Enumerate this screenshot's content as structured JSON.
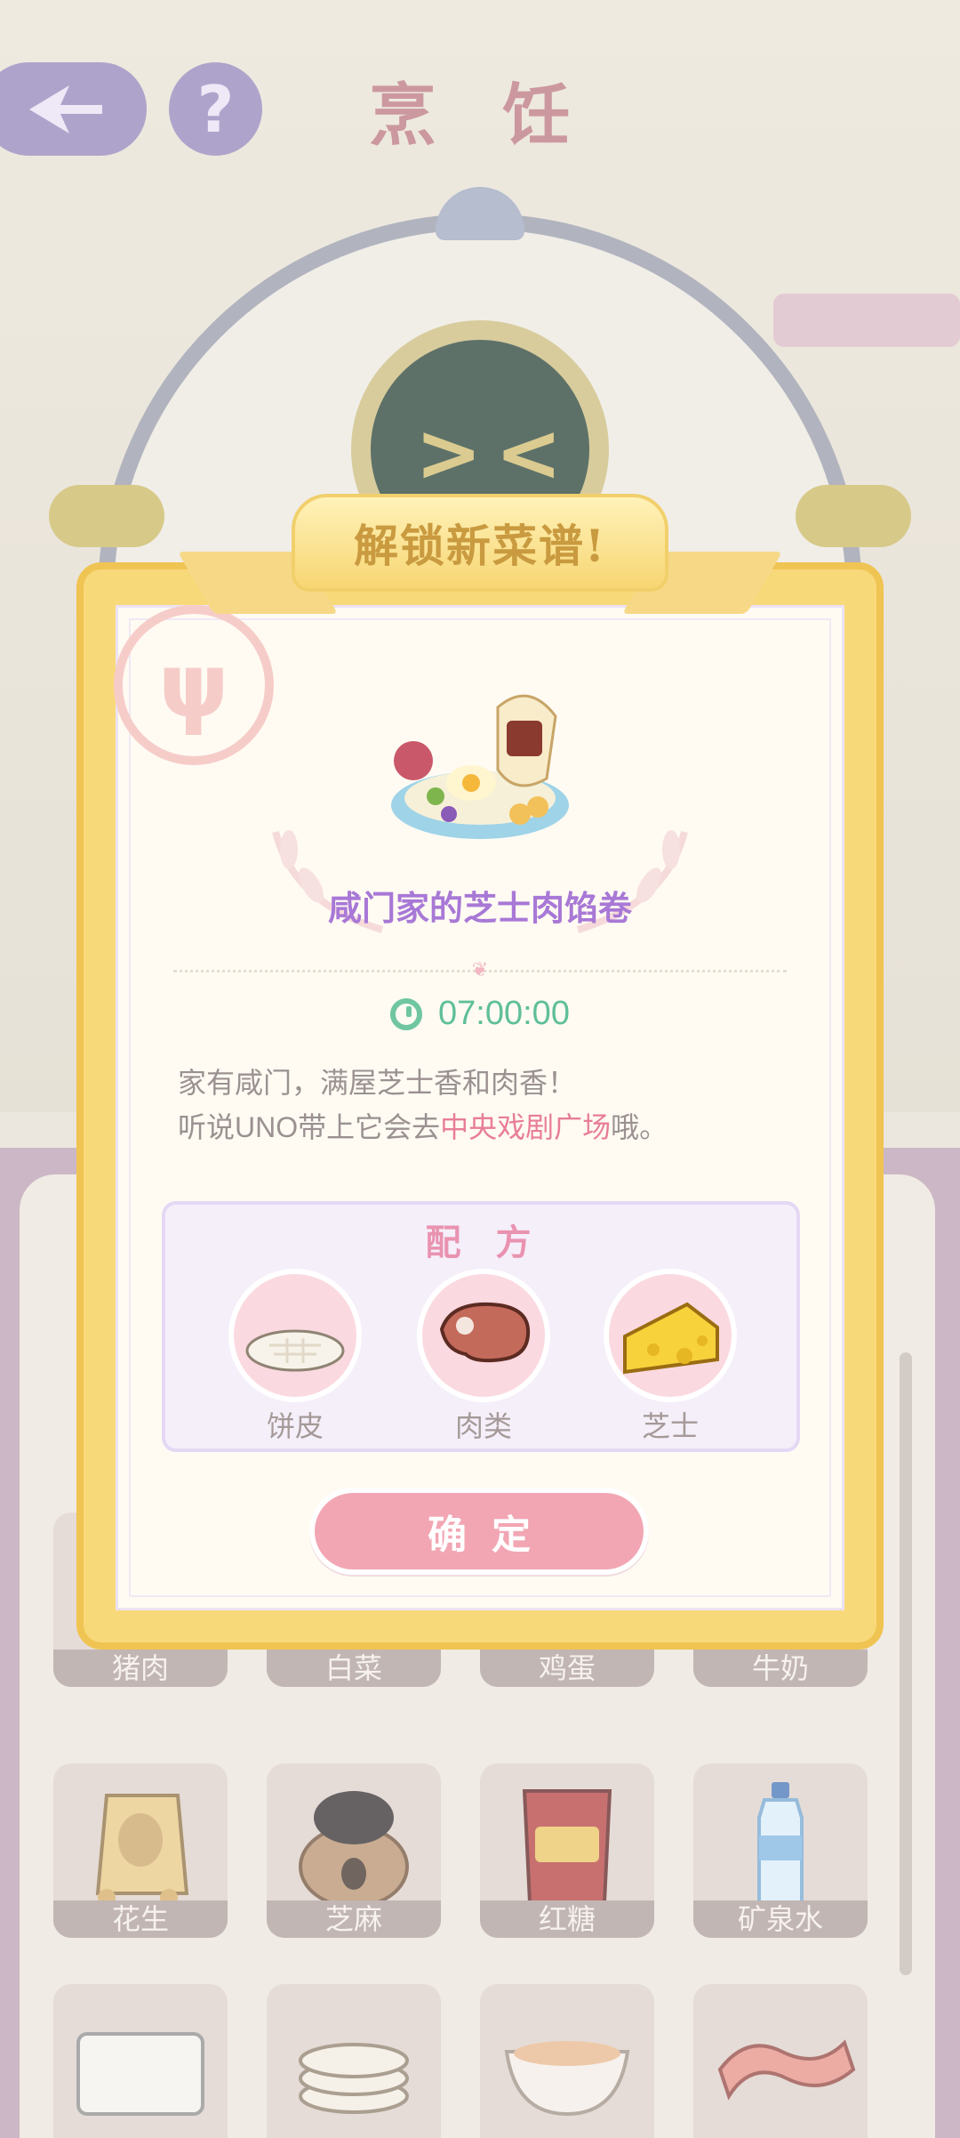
{
  "header": {
    "title": "烹 饪",
    "help_glyph": "?"
  },
  "modal": {
    "banner": "解锁新菜谱!",
    "dish_name": "咸门家的芝士肉馅卷",
    "timer": "07:00:00",
    "description_line1": "家有咸门，满屋芝士香和肉香！",
    "description_line2_pre": "听说UNO带上它会去",
    "description_line2_highlight": "中央戏剧广场",
    "description_line2_post": "哦。",
    "recipe": {
      "title": "配 方",
      "ingredients": [
        {
          "label": "饼皮",
          "icon": "flatbread-icon"
        },
        {
          "label": "肉类",
          "icon": "meat-icon"
        },
        {
          "label": "芝士",
          "icon": "cheese-icon"
        }
      ]
    },
    "confirm_label": "确定"
  },
  "grid": {
    "row1": [
      "猪肉",
      "白菜",
      "鸡蛋",
      "牛奶"
    ],
    "row2": [
      "花生",
      "芝麻",
      "红糖",
      "矿泉水"
    ],
    "row2_icons": [
      "peanut-bag-icon",
      "sesame-sack-icon",
      "brown-sugar-bag-icon",
      "water-bottle-icon"
    ],
    "row3_icons": [
      "tofu-box-icon",
      "flatbread-stack-icon",
      "bowl-icon",
      "bacon-icon"
    ]
  },
  "colors": {
    "modal_border": "#f8d97a",
    "dish_name": "#a878d6",
    "timer": "#5fbf98",
    "highlight": "#e87e96",
    "confirm": "#f2a6b3"
  }
}
